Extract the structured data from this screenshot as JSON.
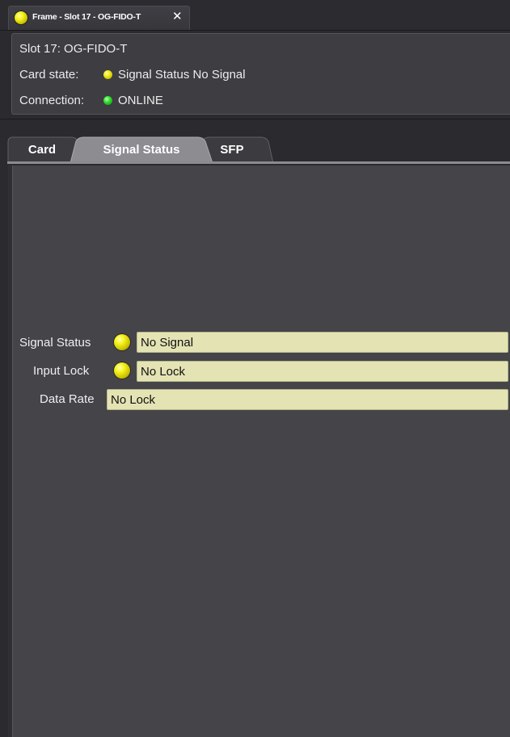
{
  "window": {
    "tab_title": "Frame - Slot 17 - OG-FIDO-T",
    "close_glyph": "✕",
    "tab_led_color": "#f3ef17"
  },
  "info": {
    "slot_text": "Slot 17: OG-FIDO-T",
    "card_state_label": "Card state:",
    "card_state_value": "Signal Status No Signal",
    "card_state_led_color": "#eeea10",
    "connection_label": "Connection:",
    "connection_value": "ONLINE",
    "connection_led_color": "#2ee02a"
  },
  "section_tabs": [
    {
      "label": "Card",
      "active": false
    },
    {
      "label": "Signal Status",
      "active": true
    },
    {
      "label": "SFP",
      "active": false
    }
  ],
  "signal_status": {
    "fields": [
      {
        "label": "Signal Status",
        "value": "No Signal",
        "led": "yellow"
      },
      {
        "label": "Input Lock",
        "value": "No Lock",
        "led": "yellow"
      },
      {
        "label": "Data Rate",
        "value": "No Lock",
        "led": null
      }
    ]
  },
  "colors": {
    "field_background": "#e4e3b4",
    "led_yellow": "#f6f21c",
    "led_green": "#2ee02a",
    "panel_background": "#444449"
  }
}
